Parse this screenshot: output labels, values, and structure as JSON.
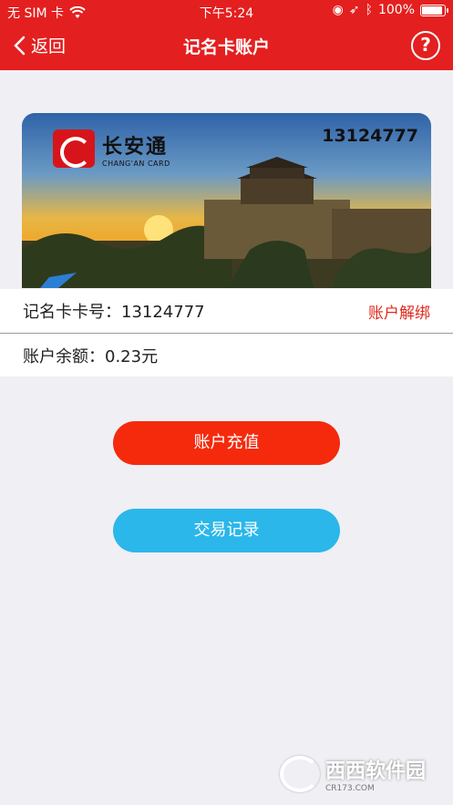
{
  "status": {
    "carrier": "无 SIM 卡",
    "time": "下午5:24",
    "battery": "100%"
  },
  "nav": {
    "back_label": "返回",
    "title": "记名卡账户"
  },
  "card": {
    "brand_cn": "长安通",
    "brand_en": "CHANG'AN CARD",
    "number": "13124777"
  },
  "info": {
    "card_no_label": "记名卡卡号：13124777",
    "unbind_label": "账户解绑",
    "balance_label": "账户余额：0.23元"
  },
  "actions": {
    "recharge_label": "账户充值",
    "records_label": "交易记录"
  },
  "watermark": {
    "text": "西西软件园",
    "sub": "CR173.COM"
  },
  "colors": {
    "nav": "#e41f1f",
    "recharge": "#f52a0c",
    "records": "#2bb7ea",
    "unbind": "#e2291c"
  }
}
